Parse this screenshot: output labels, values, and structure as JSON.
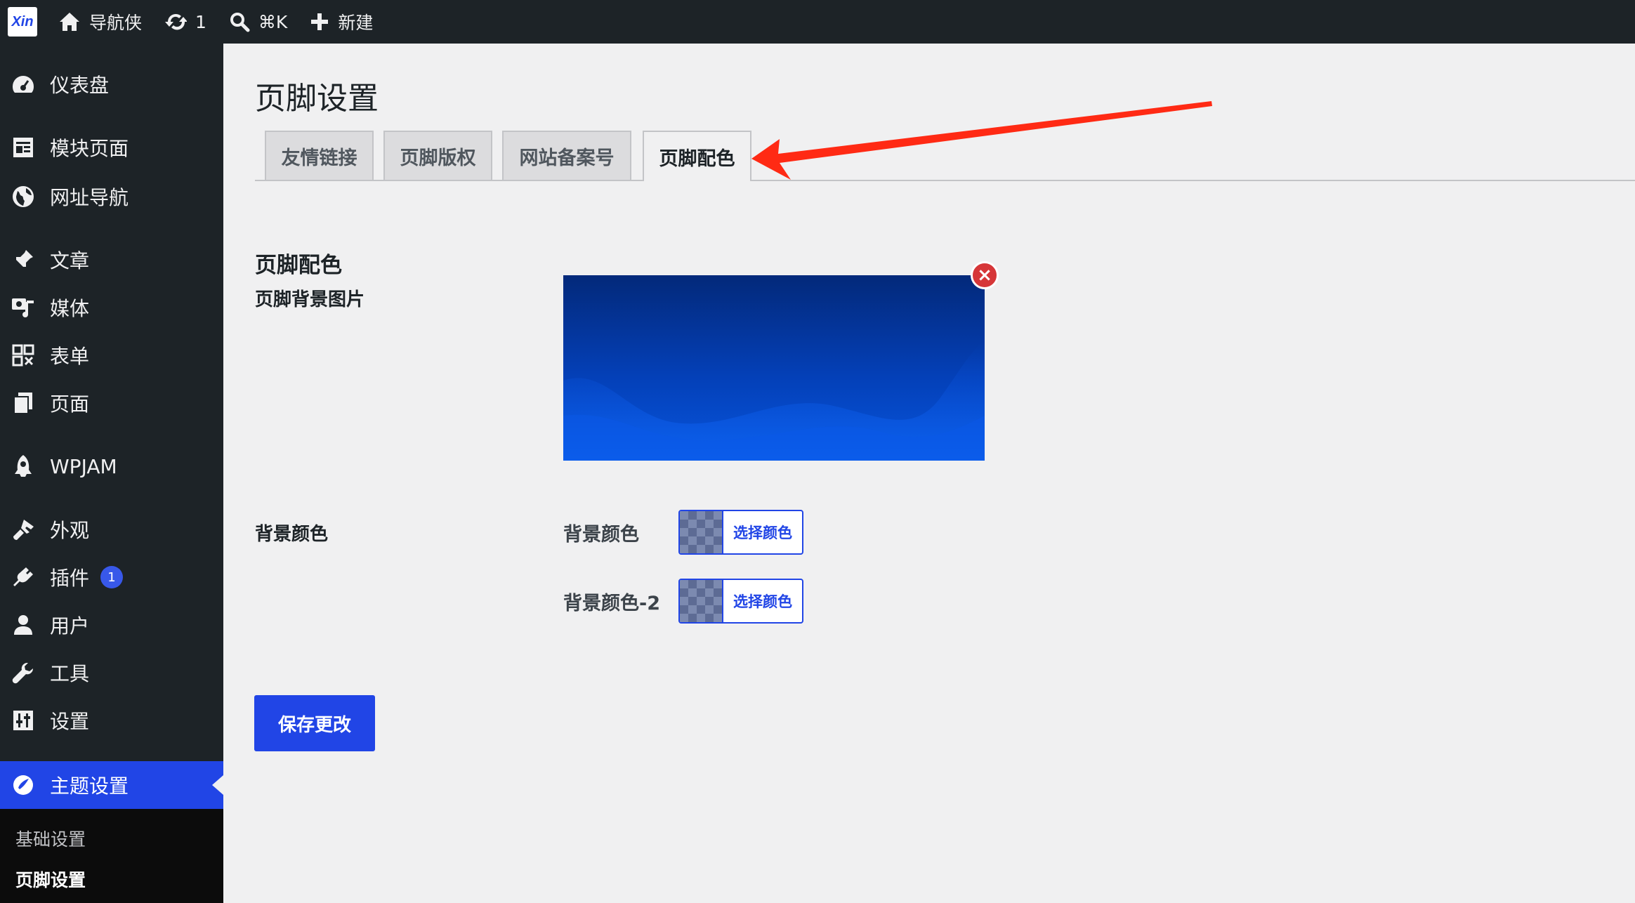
{
  "adminbar": {
    "logo": "Xin",
    "site_name": "导航侠",
    "updates_count": "1",
    "search_shortcut": "⌘K",
    "new_label": "新建"
  },
  "sidebar": {
    "items": [
      {
        "label": "仪表盘",
        "icon": "dashboard-icon"
      },
      {
        "label": "模块页面",
        "icon": "module-page-icon"
      },
      {
        "label": "网址导航",
        "icon": "globe-icon"
      },
      {
        "label": "文章",
        "icon": "pin-icon"
      },
      {
        "label": "媒体",
        "icon": "media-icon"
      },
      {
        "label": "表单",
        "icon": "form-icon"
      },
      {
        "label": "页面",
        "icon": "page-icon"
      },
      {
        "label": "WPJAM",
        "icon": "rocket-icon"
      },
      {
        "label": "外观",
        "icon": "brush-icon"
      },
      {
        "label": "插件",
        "icon": "plugin-icon",
        "badge": "1"
      },
      {
        "label": "用户",
        "icon": "user-icon"
      },
      {
        "label": "工具",
        "icon": "wrench-icon"
      },
      {
        "label": "设置",
        "icon": "settings-icon"
      },
      {
        "label": "主题设置",
        "icon": "theme-icon",
        "active": true
      }
    ],
    "submenu": [
      "基础设置",
      "页脚设置"
    ]
  },
  "main": {
    "page_title": "页脚设置",
    "tabs": [
      {
        "label": "友情链接"
      },
      {
        "label": "页脚版权"
      },
      {
        "label": "网站备案号"
      },
      {
        "label": "页脚配色",
        "active": true
      }
    ],
    "section_title": "页脚配色",
    "fields": {
      "bg_image_label": "页脚背景图片",
      "bg_color_label": "背景颜色",
      "color_rows": [
        {
          "label": "背景颜色",
          "button": "选择颜色"
        },
        {
          "label": "背景颜色-2",
          "button": "选择颜色"
        }
      ]
    },
    "save_button": "保存更改"
  },
  "colors": {
    "accent": "#2145e6",
    "adminbar_bg": "#1d2327",
    "arrow": "#ff2a14",
    "remove": "#d63638"
  }
}
